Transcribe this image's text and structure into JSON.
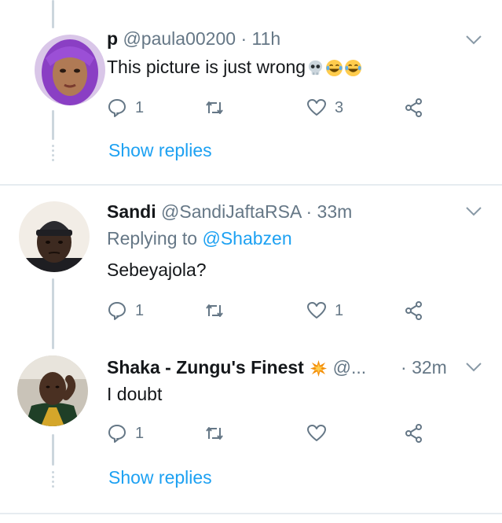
{
  "tweets": [
    {
      "display_name": "p",
      "handle": "@paula00200",
      "separator": "·",
      "time": "11h",
      "text": "This picture is just wrong",
      "emojis": [
        "skull-emoji",
        "joy-emoji",
        "joy-emoji"
      ],
      "reply_count": "1",
      "like_count": "3",
      "show_replies": "Show replies",
      "avatar": "purple-hair-avatar"
    },
    {
      "display_name": "Sandi",
      "handle": "@SandiJaftaRSA",
      "separator": "·",
      "time": "33m",
      "replying_label": "Replying to",
      "replying_mention": "@Shabzen",
      "text": "Sebeyajola?",
      "reply_count": "1",
      "like_count": "1",
      "avatar": "beanie-avatar"
    },
    {
      "display_name": "Shaka - Zungu's Finest",
      "name_emoji": "collision-emoji",
      "handle": "@...",
      "separator": "·",
      "time": "32m",
      "text": "I doubt",
      "reply_count": "1",
      "like_count": "",
      "show_replies": "Show replies",
      "avatar": "car-selfie-avatar"
    }
  ],
  "icons": {
    "reply": "reply-icon",
    "retweet": "retweet-icon",
    "like": "heart-icon",
    "share": "share-icon",
    "more": "chevron-down-icon"
  },
  "colors": {
    "accent": "#1da1f2",
    "secondary_text": "#657786",
    "primary_text": "#14171a",
    "divider": "#e6ecf0",
    "thread_line": "#ccd6dd"
  }
}
